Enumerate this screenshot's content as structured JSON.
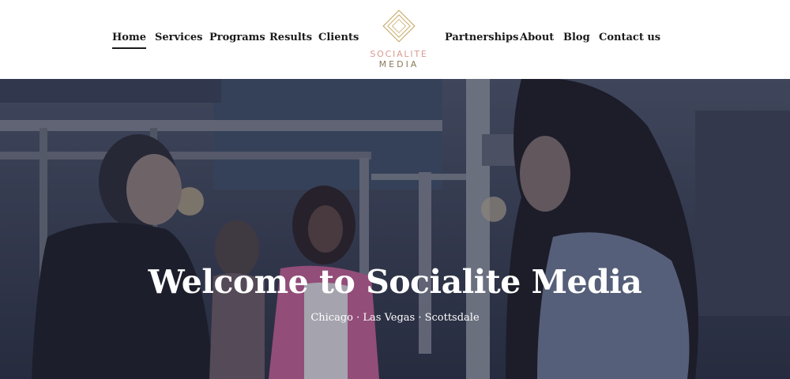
{
  "nav": {
    "left": [
      {
        "label": "Home",
        "active": true
      },
      {
        "label": "Services"
      },
      {
        "label": "Programs"
      },
      {
        "label": "Results"
      },
      {
        "label": "Clients"
      }
    ],
    "right": [
      {
        "label": "Partnerships"
      },
      {
        "label": "About"
      },
      {
        "label": "Blog"
      },
      {
        "label": "Contact us"
      }
    ]
  },
  "logo": {
    "line1": "SOCIALITE",
    "line2": "MEDIA",
    "colors": {
      "gold": "#c9ad6e",
      "pink": "#d99a90"
    }
  },
  "hero": {
    "title": "Welcome to Socialite Media",
    "subtitle": "Chicago · Las Vegas · Scottsdale"
  }
}
